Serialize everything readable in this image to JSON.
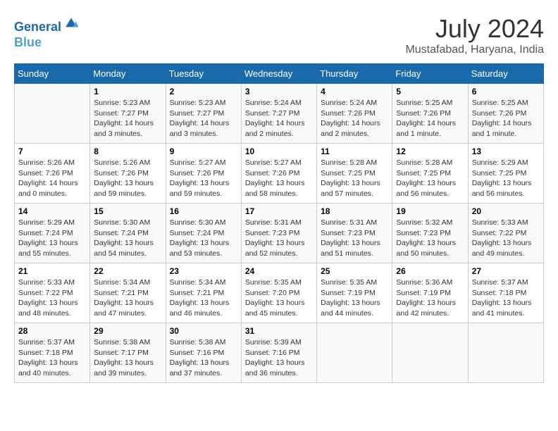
{
  "header": {
    "logo_line1": "General",
    "logo_line2": "Blue",
    "month_title": "July 2024",
    "location": "Mustafabad, Haryana, India"
  },
  "days_of_week": [
    "Sunday",
    "Monday",
    "Tuesday",
    "Wednesday",
    "Thursday",
    "Friday",
    "Saturday"
  ],
  "weeks": [
    [
      {
        "day": "",
        "info": ""
      },
      {
        "day": "1",
        "info": "Sunrise: 5:23 AM\nSunset: 7:27 PM\nDaylight: 14 hours\nand 3 minutes."
      },
      {
        "day": "2",
        "info": "Sunrise: 5:23 AM\nSunset: 7:27 PM\nDaylight: 14 hours\nand 3 minutes."
      },
      {
        "day": "3",
        "info": "Sunrise: 5:24 AM\nSunset: 7:27 PM\nDaylight: 14 hours\nand 2 minutes."
      },
      {
        "day": "4",
        "info": "Sunrise: 5:24 AM\nSunset: 7:26 PM\nDaylight: 14 hours\nand 2 minutes."
      },
      {
        "day": "5",
        "info": "Sunrise: 5:25 AM\nSunset: 7:26 PM\nDaylight: 14 hours\nand 1 minute."
      },
      {
        "day": "6",
        "info": "Sunrise: 5:25 AM\nSunset: 7:26 PM\nDaylight: 14 hours\nand 1 minute."
      }
    ],
    [
      {
        "day": "7",
        "info": "Sunrise: 5:26 AM\nSunset: 7:26 PM\nDaylight: 14 hours\nand 0 minutes."
      },
      {
        "day": "8",
        "info": "Sunrise: 5:26 AM\nSunset: 7:26 PM\nDaylight: 13 hours\nand 59 minutes."
      },
      {
        "day": "9",
        "info": "Sunrise: 5:27 AM\nSunset: 7:26 PM\nDaylight: 13 hours\nand 59 minutes."
      },
      {
        "day": "10",
        "info": "Sunrise: 5:27 AM\nSunset: 7:26 PM\nDaylight: 13 hours\nand 58 minutes."
      },
      {
        "day": "11",
        "info": "Sunrise: 5:28 AM\nSunset: 7:25 PM\nDaylight: 13 hours\nand 57 minutes."
      },
      {
        "day": "12",
        "info": "Sunrise: 5:28 AM\nSunset: 7:25 PM\nDaylight: 13 hours\nand 56 minutes."
      },
      {
        "day": "13",
        "info": "Sunrise: 5:29 AM\nSunset: 7:25 PM\nDaylight: 13 hours\nand 56 minutes."
      }
    ],
    [
      {
        "day": "14",
        "info": "Sunrise: 5:29 AM\nSunset: 7:24 PM\nDaylight: 13 hours\nand 55 minutes."
      },
      {
        "day": "15",
        "info": "Sunrise: 5:30 AM\nSunset: 7:24 PM\nDaylight: 13 hours\nand 54 minutes."
      },
      {
        "day": "16",
        "info": "Sunrise: 5:30 AM\nSunset: 7:24 PM\nDaylight: 13 hours\nand 53 minutes."
      },
      {
        "day": "17",
        "info": "Sunrise: 5:31 AM\nSunset: 7:23 PM\nDaylight: 13 hours\nand 52 minutes."
      },
      {
        "day": "18",
        "info": "Sunrise: 5:31 AM\nSunset: 7:23 PM\nDaylight: 13 hours\nand 51 minutes."
      },
      {
        "day": "19",
        "info": "Sunrise: 5:32 AM\nSunset: 7:23 PM\nDaylight: 13 hours\nand 50 minutes."
      },
      {
        "day": "20",
        "info": "Sunrise: 5:33 AM\nSunset: 7:22 PM\nDaylight: 13 hours\nand 49 minutes."
      }
    ],
    [
      {
        "day": "21",
        "info": "Sunrise: 5:33 AM\nSunset: 7:22 PM\nDaylight: 13 hours\nand 48 minutes."
      },
      {
        "day": "22",
        "info": "Sunrise: 5:34 AM\nSunset: 7:21 PM\nDaylight: 13 hours\nand 47 minutes."
      },
      {
        "day": "23",
        "info": "Sunrise: 5:34 AM\nSunset: 7:21 PM\nDaylight: 13 hours\nand 46 minutes."
      },
      {
        "day": "24",
        "info": "Sunrise: 5:35 AM\nSunset: 7:20 PM\nDaylight: 13 hours\nand 45 minutes."
      },
      {
        "day": "25",
        "info": "Sunrise: 5:35 AM\nSunset: 7:19 PM\nDaylight: 13 hours\nand 44 minutes."
      },
      {
        "day": "26",
        "info": "Sunrise: 5:36 AM\nSunset: 7:19 PM\nDaylight: 13 hours\nand 42 minutes."
      },
      {
        "day": "27",
        "info": "Sunrise: 5:37 AM\nSunset: 7:18 PM\nDaylight: 13 hours\nand 41 minutes."
      }
    ],
    [
      {
        "day": "28",
        "info": "Sunrise: 5:37 AM\nSunset: 7:18 PM\nDaylight: 13 hours\nand 40 minutes."
      },
      {
        "day": "29",
        "info": "Sunrise: 5:38 AM\nSunset: 7:17 PM\nDaylight: 13 hours\nand 39 minutes."
      },
      {
        "day": "30",
        "info": "Sunrise: 5:38 AM\nSunset: 7:16 PM\nDaylight: 13 hours\nand 37 minutes."
      },
      {
        "day": "31",
        "info": "Sunrise: 5:39 AM\nSunset: 7:16 PM\nDaylight: 13 hours\nand 36 minutes."
      },
      {
        "day": "",
        "info": ""
      },
      {
        "day": "",
        "info": ""
      },
      {
        "day": "",
        "info": ""
      }
    ]
  ]
}
